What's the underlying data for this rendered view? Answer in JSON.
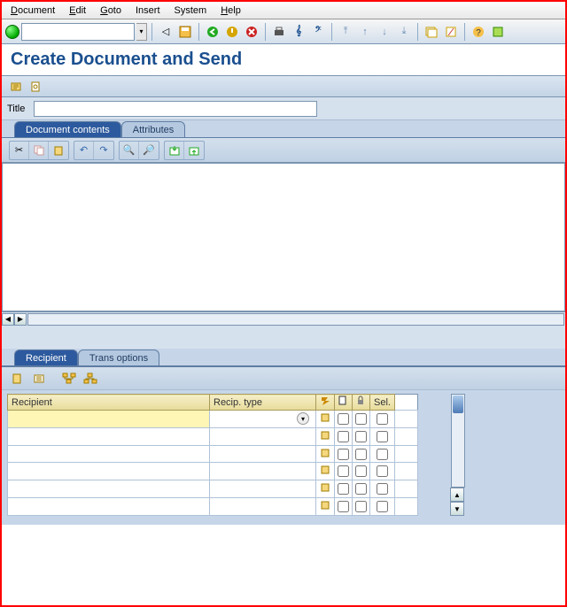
{
  "menu": {
    "document": "Document",
    "edit": "Edit",
    "goto": "Goto",
    "insert": "Insert",
    "system": "System",
    "help": "Help"
  },
  "page_title": "Create Document and Send",
  "title_field": {
    "label": "Title",
    "value": ""
  },
  "tabs_upper": {
    "doc_contents": "Document contents",
    "attributes": "Attributes"
  },
  "tabs_lower": {
    "recipient": "Recipient",
    "trans_options": "Trans options"
  },
  "grid": {
    "headers": {
      "recipient": "Recipient",
      "recip_type": "Recip. type",
      "sel": "Sel."
    },
    "rows": [
      {
        "recipient": "",
        "recip_type": "",
        "c1": false,
        "c2": false,
        "c3": false
      },
      {
        "recipient": "",
        "recip_type": "",
        "c1": false,
        "c2": false,
        "c3": false
      },
      {
        "recipient": "",
        "recip_type": "",
        "c1": false,
        "c2": false,
        "c3": false
      },
      {
        "recipient": "",
        "recip_type": "",
        "c1": false,
        "c2": false,
        "c3": false
      },
      {
        "recipient": "",
        "recip_type": "",
        "c1": false,
        "c2": false,
        "c3": false
      },
      {
        "recipient": "",
        "recip_type": "",
        "c1": false,
        "c2": false,
        "c3": false
      }
    ]
  }
}
